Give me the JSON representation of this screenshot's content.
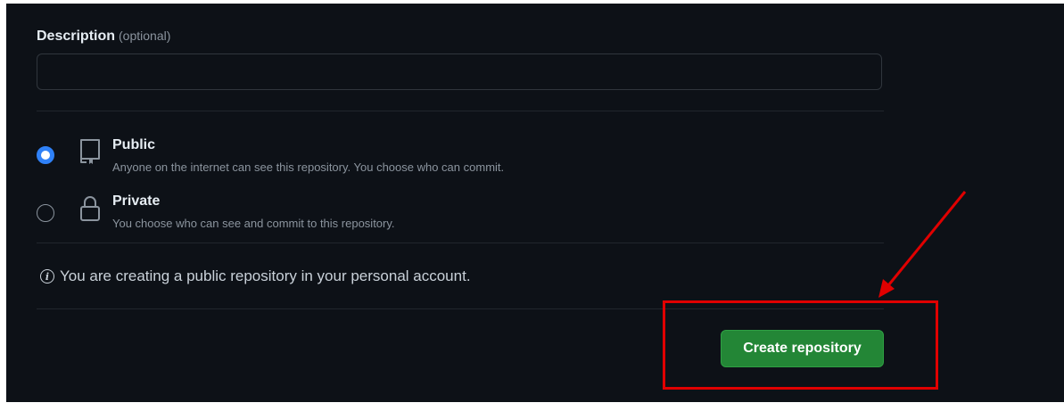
{
  "description": {
    "label": "Description",
    "optional_text": "(optional)",
    "value": "",
    "placeholder": ""
  },
  "visibility": {
    "options": [
      {
        "title": "Public",
        "description": "Anyone on the internet can see this repository. You choose who can commit.",
        "icon": "repo-icon",
        "selected": true
      },
      {
        "title": "Private",
        "description": "You choose who can see and commit to this repository.",
        "icon": "lock-icon",
        "selected": false
      }
    ]
  },
  "info": {
    "icon": "info-icon",
    "text": "You are creating a public repository in your personal account."
  },
  "create_button": {
    "label": "Create repository"
  },
  "annotation": {
    "color": "#e00000",
    "shapes": [
      "highlight-box",
      "arrow"
    ]
  },
  "colors": {
    "background": "#0d1117",
    "primary_button": "#238636",
    "radio_selected": "#2f81f7",
    "text_primary": "#e6edf3",
    "text_muted": "#8b949e"
  }
}
